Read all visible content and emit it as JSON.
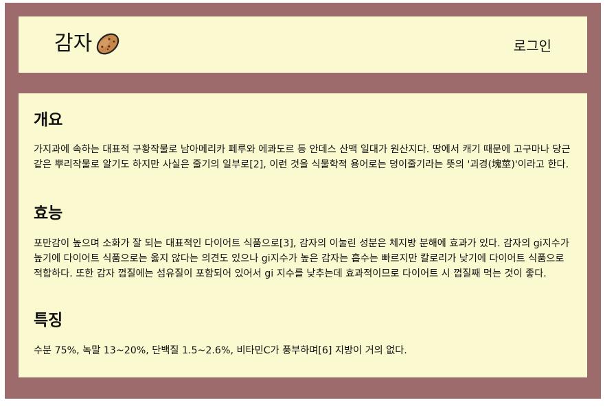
{
  "header": {
    "title": "감자",
    "logo_icon": "potato-icon",
    "login_label": "로그인"
  },
  "sections": [
    {
      "title": "개요",
      "body": "가지과에 속하는 대표적 구황작물로 남아메리카 페루와 에콰도르 등 안데스 산맥 일대가 원산지다. 땅에서 캐기 때문에 고구마나 당근 같은 뿌리작물로 알기도 하지만 사실은 줄기의 일부로[2], 이런 것을 식물학적 용어로는 덩이줄기라는 뜻의 '괴경(塊莖)'이라고 한다."
    },
    {
      "title": "효능",
      "body": "포만감이 높으며 소화가 잘 되는 대표적인 다이어트 식품으로[3], 감자의 이눌린 성분은 체지방 분해에 효과가 있다. 감자의 gi지수가 높기에 다이어트 식품으로는 옳지 않다는 의견도 있으나 gi지수가 높은 감자는 흡수는 빠르지만 칼로리가 낮기에 다이어트 식품으로 적합하다. 또한 감자 껍질에는 섬유질이 포함되어 있어서 gi 지수를 낮추는데 효과적이므로 다이어트 시 껍질째 먹는 것이 좋다."
    },
    {
      "title": "특징",
      "body": "수분 75%, 녹말 13~20%, 단백질 1.5~2.6%, 비타민C가 풍부하며[6] 지방이 거의 없다."
    }
  ],
  "colors": {
    "frame": "#9e6b6c",
    "panel": "#fbf9cf",
    "text": "#111111"
  }
}
